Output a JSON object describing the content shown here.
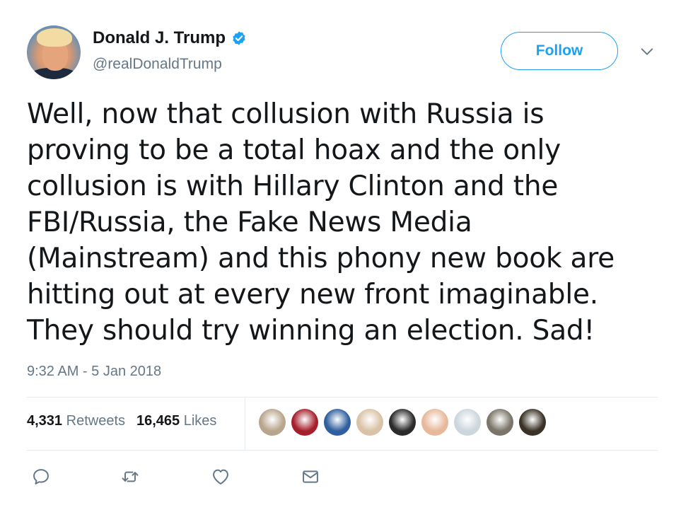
{
  "user": {
    "display_name": "Donald J. Trump",
    "handle": "@realDonaldTrump",
    "verified": true
  },
  "follow_button": {
    "label": "Follow"
  },
  "tweet": {
    "lines": [
      "Well, now that collusion with Russia is",
      "proving to be a total hoax and the only",
      "collusion is with Hillary Clinton and the",
      "FBI/Russia, the Fake News Media",
      "(Mainstream) and this phony new book are",
      "hitting out at every new front imaginable.",
      "They should try winning an election. Sad!"
    ],
    "timestamp": "9:32 AM - 5 Jan 2018"
  },
  "stats": {
    "retweets_count": "4,331",
    "retweets_label": "Retweets",
    "likes_count": "16,465",
    "likes_label": "Likes"
  },
  "liker_avatars": [
    {
      "color": "#b8a58c"
    },
    {
      "color": "#a5202c"
    },
    {
      "color": "#2f5f9e"
    },
    {
      "color": "#d9c2a6"
    },
    {
      "color": "#2b2b2b"
    },
    {
      "color": "#e7b89a"
    },
    {
      "color": "#ccd6dd"
    },
    {
      "color": "#7a7568"
    },
    {
      "color": "#3a3226"
    }
  ],
  "actions": [
    {
      "icon": "reply-icon"
    },
    {
      "icon": "retweet-icon"
    },
    {
      "icon": "like-icon"
    },
    {
      "icon": "direct-message-icon"
    }
  ],
  "colors": {
    "accent": "#1da1f2",
    "muted": "#657786",
    "text": "#14171a",
    "divider": "#e6ecf0"
  }
}
